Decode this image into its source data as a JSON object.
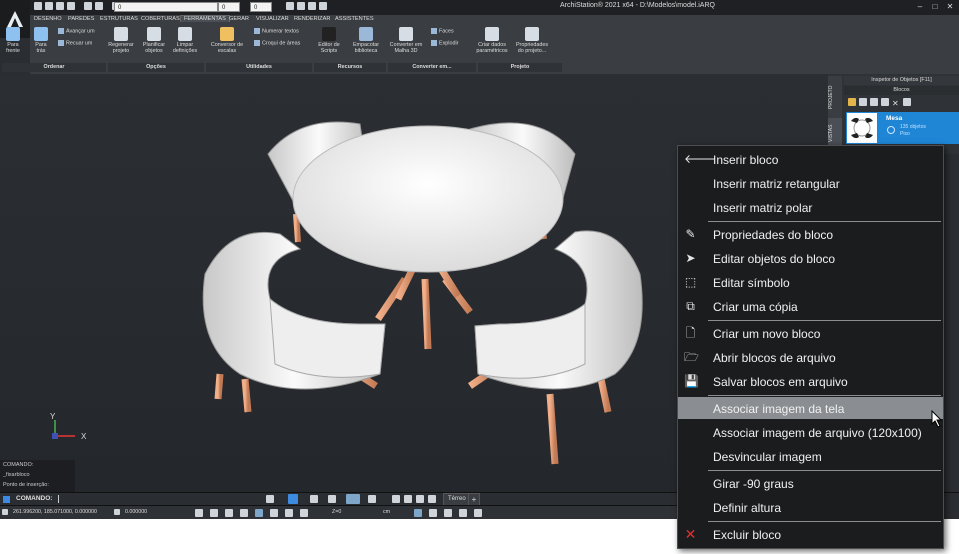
{
  "app": {
    "title": "ArchiStation® 2021 x64  -  D:\\Modelos\\model.iARQ",
    "layer_combo": "0",
    "color_combo_1": "0",
    "color_combo_2": "0"
  },
  "menu_tabs": [
    "DESENHO",
    "PAREDES",
    "ESTRUTURAS",
    "COBERTURAS",
    "FERRAMENTAS",
    "GERAR",
    "VISUALIZAR",
    "RENDERIZAR",
    "ASSISTENTES"
  ],
  "active_tab": "FERRAMENTAS",
  "ribbon": {
    "buttons": [
      {
        "id": "para-frente",
        "label": "Para\nfrente"
      },
      {
        "id": "para-tras",
        "label": "Para\ntrás"
      },
      {
        "id": "regenerar-projeto",
        "label": "Regenerar\nprojeto"
      },
      {
        "id": "planificar-objetos",
        "label": "Planificar\nobjetos"
      },
      {
        "id": "limpar-definicoes",
        "label": "Limpar\ndefinições"
      },
      {
        "id": "conversor-de-escalas",
        "label": "Conversor de\nescalas"
      },
      {
        "id": "editor-de-scripts",
        "label": "Editor de\nScripts"
      },
      {
        "id": "empacotar-biblioteca",
        "label": "Empacotar\nbiblioteca"
      },
      {
        "id": "converter-em-malha",
        "label": "Converter em\nMalha 3D"
      },
      {
        "id": "criar-dados-parametricos",
        "label": "Criar dados\nparamétricos"
      },
      {
        "id": "propriedades-do-projeto",
        "label": "Propriedades\ndo projeto..."
      }
    ],
    "small": {
      "avancar_um": "Avançar um",
      "recuar_um": "Recuar um",
      "numerar_textos": "Numerar textos",
      "croqui_de_areas": "Croqui de áreas",
      "faces": "Faces",
      "explodir": "Explodir"
    },
    "groups": [
      "Ordenar",
      "Opções",
      "Utilidades",
      "Recursos",
      "Converter em...",
      "Projeto"
    ]
  },
  "right_panel": {
    "vtabs": [
      "PROJETO",
      "VISTAS"
    ],
    "inspector_title": "Inspetor de Objetos [F11]",
    "blocos_title": "Blocos",
    "block_name": "Mesa",
    "block_sub1": "135 objetos",
    "block_sub2": "Piso"
  },
  "viewport": {
    "axis_y": "Y",
    "axis_x": "X"
  },
  "command": {
    "lines": [
      "COMANDO:",
      "_fixarbloco",
      "Ponto de inserção:"
    ],
    "prompt": "COMANDO:",
    "view_tab": "Térreo",
    "add_tab": "+"
  },
  "status": {
    "coords": "261.996200, 185.071000, 0.000000",
    "angle": "0.000000",
    "z": "Z=0",
    "unit": "cm"
  },
  "context_menu": {
    "groups": [
      [
        {
          "icon": "arrow-left",
          "glyph": "🡐",
          "label": "Inserir bloco"
        },
        {
          "icon": "",
          "glyph": "",
          "label": "Inserir matriz retangular"
        },
        {
          "icon": "",
          "glyph": "",
          "label": "Inserir matriz polar"
        }
      ],
      [
        {
          "icon": "properties",
          "glyph": "✎",
          "label": "Propriedades do bloco"
        },
        {
          "icon": "cursor",
          "glyph": "➤",
          "label": "Editar objetos do bloco"
        },
        {
          "icon": "select-box",
          "glyph": "⬚",
          "label": "Editar símbolo"
        },
        {
          "icon": "copy",
          "glyph": "⧉",
          "label": "Criar uma cópia"
        }
      ],
      [
        {
          "icon": "new-file",
          "glyph": "🗋",
          "label": "Criar um novo bloco"
        },
        {
          "icon": "folder-open",
          "glyph": "🗁",
          "label": "Abrir blocos de arquivo"
        },
        {
          "icon": "floppy",
          "glyph": "💾",
          "label": "Salvar blocos em arquivo"
        }
      ],
      [
        {
          "icon": "",
          "glyph": "",
          "label": "Associar imagem da tela",
          "hover": true
        },
        {
          "icon": "",
          "glyph": "",
          "label": "Associar imagem de arquivo (120x100)"
        },
        {
          "icon": "",
          "glyph": "",
          "label": "Desvincular imagem"
        }
      ],
      [
        {
          "icon": "",
          "glyph": "",
          "label": "Girar -90 graus"
        },
        {
          "icon": "",
          "glyph": "",
          "label": "Definir altura"
        }
      ],
      [
        {
          "icon": "delete-x",
          "glyph": "✕",
          "label": "Excluir bloco",
          "danger": true
        }
      ]
    ]
  },
  "colors": {
    "accent_blue": "#1f86d6",
    "delete_red": "#e03030",
    "wood": "#e0a07a"
  }
}
